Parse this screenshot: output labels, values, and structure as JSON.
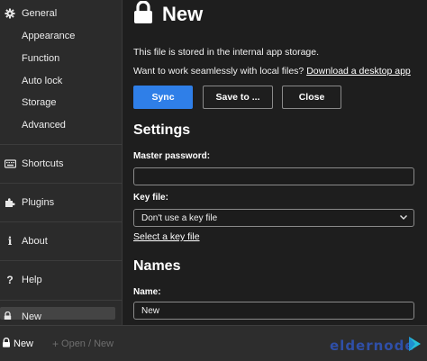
{
  "sidebar": {
    "settings_items": [
      {
        "label": "General",
        "icon": "gear-icon"
      },
      {
        "label": "Appearance"
      },
      {
        "label": "Function"
      },
      {
        "label": "Auto lock"
      },
      {
        "label": "Storage"
      },
      {
        "label": "Advanced"
      }
    ],
    "shortcuts": {
      "label": "Shortcuts",
      "icon": "keyboard-icon"
    },
    "plugins": {
      "label": "Plugins",
      "icon": "puzzle-icon"
    },
    "about": {
      "label": "About",
      "icon": "info-icon"
    },
    "help": {
      "label": "Help",
      "icon": "question-icon"
    },
    "active_file": {
      "label": "New",
      "icon": "lock-icon"
    }
  },
  "footer": {
    "new_label": "New",
    "open_label": "Open / New",
    "brand": "eldernode"
  },
  "main": {
    "title": "New",
    "storage_info": "This file is stored in the internal app storage.",
    "local_prompt": "Want to work seamlessly with local files?",
    "desktop_link": "Download a desktop app",
    "buttons": {
      "sync": "Sync",
      "save_to": "Save to ...",
      "close": "Close"
    },
    "settings_heading": "Settings",
    "master_password_label": "Master password:",
    "master_password_value": "",
    "key_file_label": "Key file:",
    "key_file_selected": "Don't use a key file",
    "select_key_file": "Select a key file",
    "names_heading": "Names",
    "name_label": "Name:",
    "name_value": "New"
  },
  "colors": {
    "accent": "#2f7fe8",
    "background": "#1e1e1e",
    "sidebar": "#2b2b2b",
    "brand": "#2f4fa8"
  }
}
